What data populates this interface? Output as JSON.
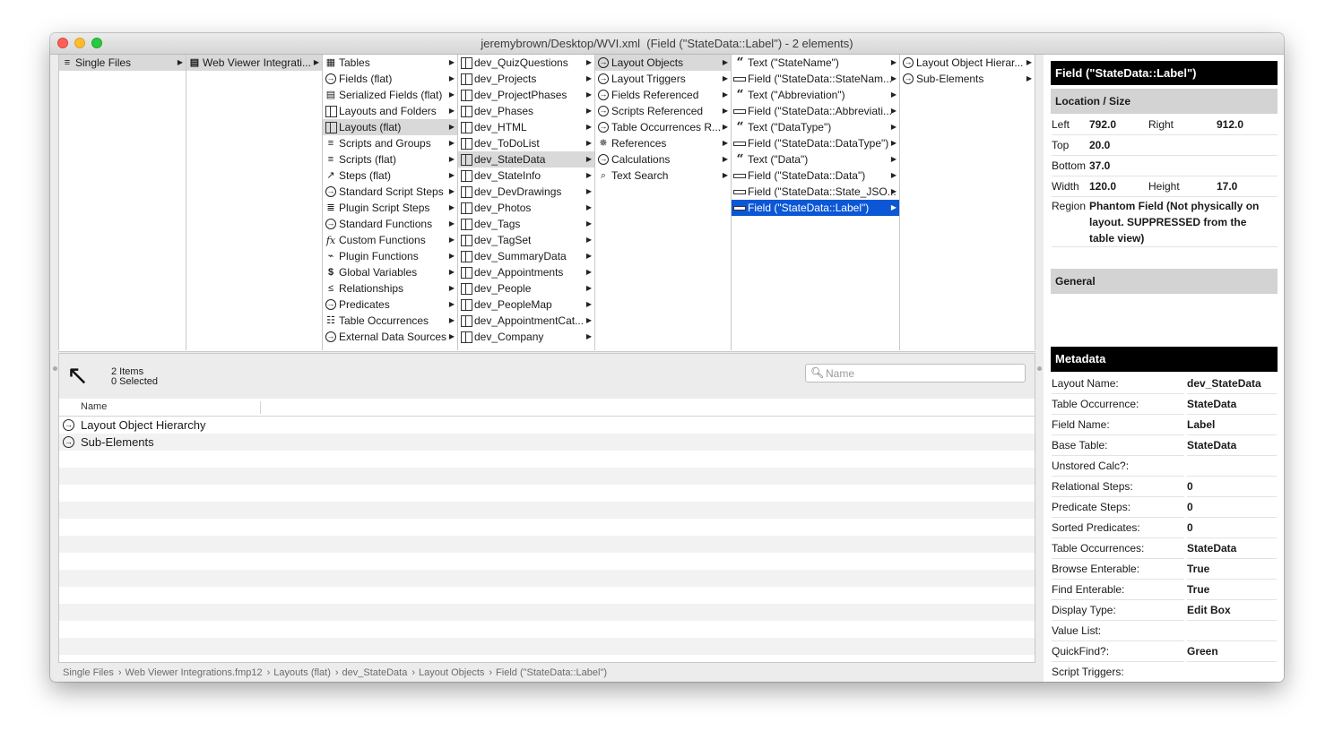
{
  "window": {
    "title": "jeremybrown/Desktop/WVI.xml  (Field (\"StateData::Label\") - 2 elements)"
  },
  "columns": {
    "col1": [
      {
        "label": "Single Files",
        "icon": "stack-icon",
        "selected": true
      }
    ],
    "col2": [
      {
        "label": "Web Viewer Integrati...",
        "icon": "database-icon",
        "selected": true
      }
    ],
    "col3": [
      {
        "label": "Tables",
        "icon": "table-icon"
      },
      {
        "label": "Fields (flat)",
        "icon": "circle-arrow-icon"
      },
      {
        "label": "Serialized Fields (flat)",
        "icon": "serialized-icon"
      },
      {
        "label": "Layouts and Folders",
        "icon": "layout-icon"
      },
      {
        "label": "Layouts (flat)",
        "icon": "layout-icon",
        "selected": true
      },
      {
        "label": "Scripts and Groups",
        "icon": "script-icon"
      },
      {
        "label": "Scripts (flat)",
        "icon": "script-icon"
      },
      {
        "label": "Steps (flat)",
        "icon": "steps-icon"
      },
      {
        "label": "Standard Script Steps",
        "icon": "circle-arrow-icon"
      },
      {
        "label": "Plugin Script Steps",
        "icon": "plugin-script-icon"
      },
      {
        "label": "Standard Functions",
        "icon": "circle-arrow-icon"
      },
      {
        "label": "Custom Functions",
        "icon": "function-icon"
      },
      {
        "label": "Plugin Functions",
        "icon": "plug-icon"
      },
      {
        "label": "Global Variables",
        "icon": "dollar-icon"
      },
      {
        "label": "Relationships",
        "icon": "share-icon"
      },
      {
        "label": "Predicates",
        "icon": "circle-arrow-icon"
      },
      {
        "label": "Table Occurrences",
        "icon": "table-occurrence-icon"
      },
      {
        "label": "External Data Sources",
        "icon": "circle-arrow-icon"
      }
    ],
    "col4": [
      {
        "label": "dev_QuizQuestions"
      },
      {
        "label": "dev_Projects"
      },
      {
        "label": "dev_ProjectPhases"
      },
      {
        "label": "dev_Phases"
      },
      {
        "label": "dev_HTML"
      },
      {
        "label": "dev_ToDoList"
      },
      {
        "label": "dev_StateData",
        "selected": true
      },
      {
        "label": "dev_StateInfo"
      },
      {
        "label": "dev_DevDrawings"
      },
      {
        "label": "dev_Photos"
      },
      {
        "label": "dev_Tags"
      },
      {
        "label": "dev_TagSet"
      },
      {
        "label": "dev_SummaryData"
      },
      {
        "label": "dev_Appointments"
      },
      {
        "label": "dev_People"
      },
      {
        "label": "dev_PeopleMap"
      },
      {
        "label": "dev_AppointmentCat..."
      },
      {
        "label": "dev_Company"
      }
    ],
    "col5": [
      {
        "label": "Layout Objects",
        "icon": "circle-arrow-icon",
        "selected": true
      },
      {
        "label": "Layout Triggers",
        "icon": "circle-arrow-icon"
      },
      {
        "label": "Fields Referenced",
        "icon": "circle-arrow-icon"
      },
      {
        "label": "Scripts Referenced",
        "icon": "circle-arrow-icon"
      },
      {
        "label": "Table Occurrences R...",
        "icon": "circle-arrow-icon"
      },
      {
        "label": "References",
        "icon": "references-icon"
      },
      {
        "label": "Calculations",
        "icon": "circle-arrow-icon"
      },
      {
        "label": "Text Search",
        "icon": "magnifier-icon"
      }
    ],
    "col6": [
      {
        "label": "Text (\"StateName\")",
        "icon": "quote-icon"
      },
      {
        "label": "Field (\"StateData::StateNam...",
        "icon": "field-icon"
      },
      {
        "label": "Text (\"Abbreviation\")",
        "icon": "quote-icon"
      },
      {
        "label": "Field (\"StateData::Abbreviati...",
        "icon": "field-icon"
      },
      {
        "label": "Text (\"DataType\")",
        "icon": "quote-icon"
      },
      {
        "label": "Field (\"StateData::DataType\")",
        "icon": "field-icon"
      },
      {
        "label": "Text (\"Data\")",
        "icon": "quote-icon"
      },
      {
        "label": "Field (\"StateData::Data\")",
        "icon": "field-icon"
      },
      {
        "label": "Field (\"StateData::State_JSO...",
        "icon": "field-icon"
      },
      {
        "label": "Field (\"StateData::Label\")",
        "icon": "field-icon",
        "active": true
      }
    ],
    "col7": [
      {
        "label": "Layout Object Hierar...",
        "icon": "circle-arrow-icon"
      },
      {
        "label": "Sub-Elements",
        "icon": "circle-arrow-icon"
      }
    ]
  },
  "list": {
    "count_items": "2 Items",
    "count_selected": "0 Selected",
    "search_placeholder": "Name",
    "column_name": "Name",
    "rows": [
      {
        "label": "Layout Object Hierarchy"
      },
      {
        "label": "Sub-Elements"
      }
    ]
  },
  "pathbar": [
    "Single Files",
    "Web Viewer Integrations.fmp12",
    "Layouts (flat)",
    "dev_StateData",
    "Layout Objects",
    "Field (\"StateData::Label\")"
  ],
  "inspector": {
    "title": "Field (\"StateData::Label\")",
    "location_section": "Location / Size",
    "left_label": "Left",
    "left_value": "792.0",
    "right_label": "Right",
    "right_value": "912.0",
    "top_label": "Top",
    "top_value": "20.0",
    "bottom_label": "Bottom",
    "bottom_value": "37.0",
    "width_label": "Width",
    "width_value": "120.0",
    "height_label": "Height",
    "height_value": "17.0",
    "region_label": "Region",
    "region_value": "Phantom Field (Not physically on layout. SUPPRESSED from the table view)",
    "general_section": "General",
    "metadata_section": "Metadata",
    "metadata": [
      {
        "key": "Layout Name:",
        "value": "dev_StateData"
      },
      {
        "key": "Table Occurrence:",
        "value": "StateData"
      },
      {
        "key": "Field Name:",
        "value": "Label"
      },
      {
        "key": "Base Table:",
        "value": "StateData"
      },
      {
        "key": "Unstored Calc?:",
        "value": ""
      },
      {
        "key": "Relational Steps:",
        "value": "0"
      },
      {
        "key": "Predicate Steps:",
        "value": "0"
      },
      {
        "key": "Sorted Predicates:",
        "value": "0"
      },
      {
        "key": "Table Occurrences:",
        "value": "StateData"
      },
      {
        "key": "Browse Enterable:",
        "value": "True"
      },
      {
        "key": "Find Enterable:",
        "value": "True"
      },
      {
        "key": "Display Type:",
        "value": "Edit Box"
      },
      {
        "key": "Value List:",
        "value": ""
      },
      {
        "key": "QuickFind?:",
        "value": "Green"
      },
      {
        "key": "Script Triggers:",
        "value": ""
      }
    ]
  },
  "colors": {
    "selection_active": "#0b57d6",
    "selection_inactive": "#d9d9d9"
  }
}
